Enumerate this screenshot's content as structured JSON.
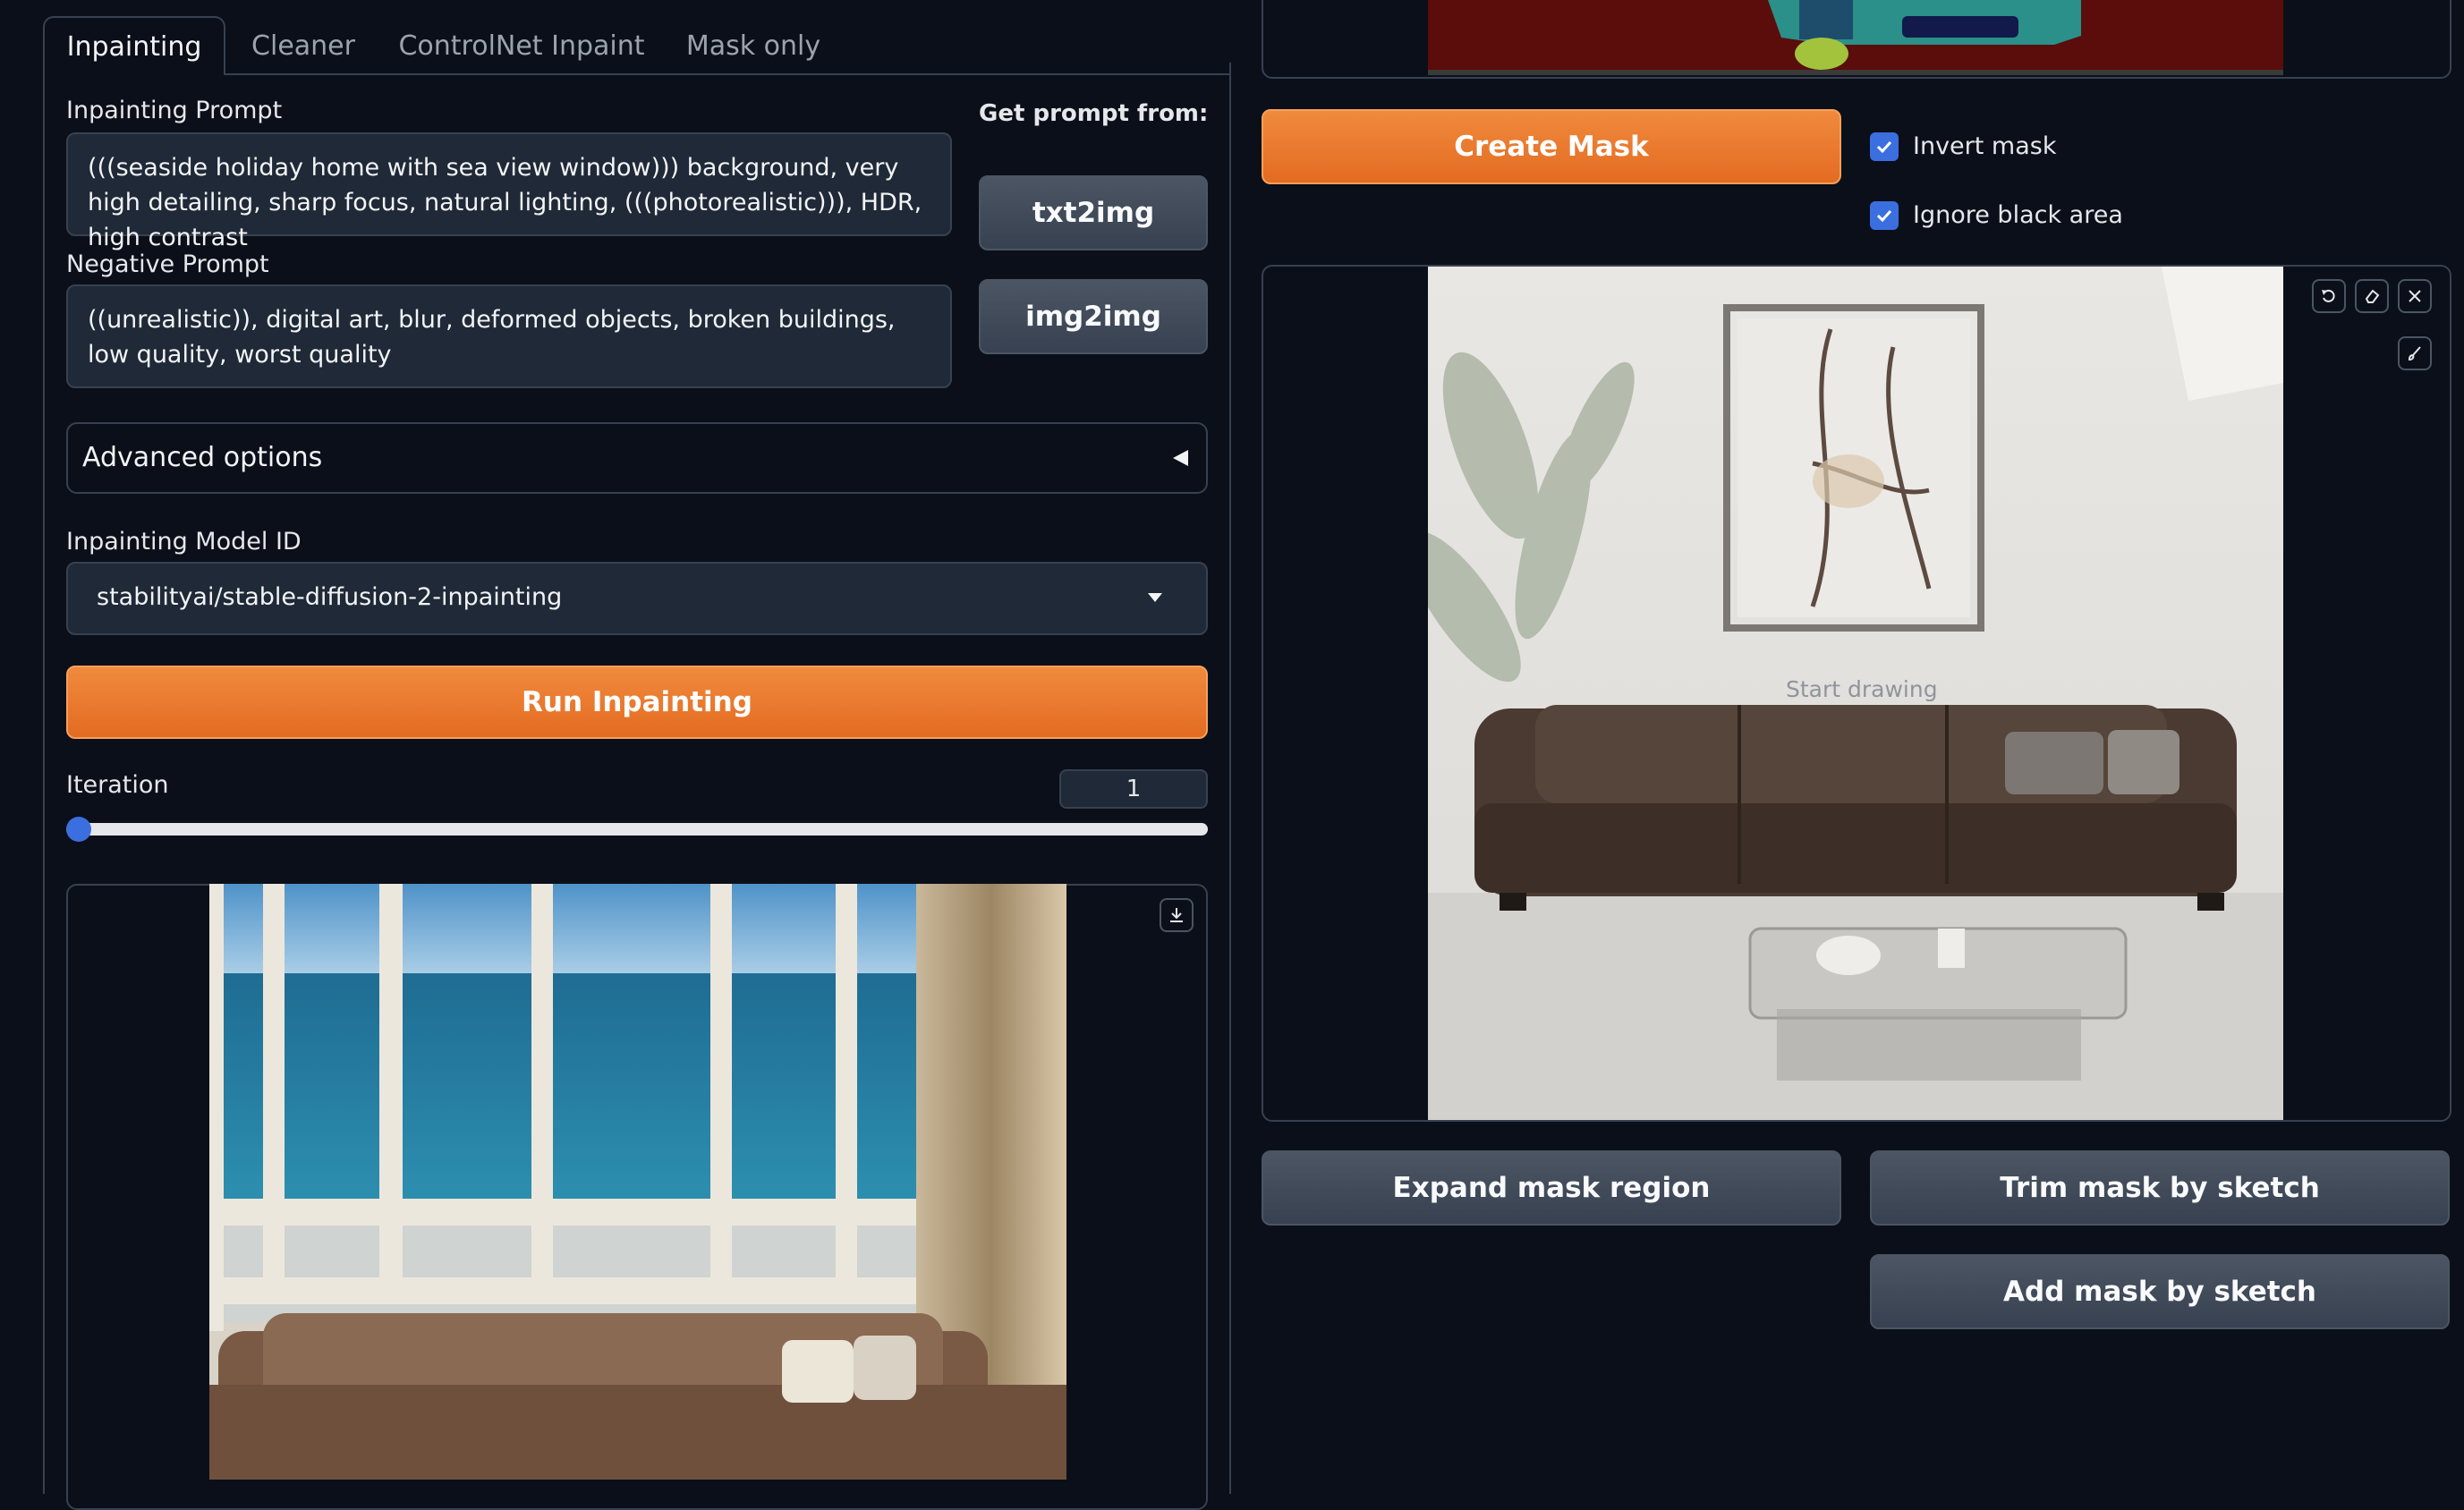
{
  "tabs": [
    {
      "label": "Inpainting",
      "active": true
    },
    {
      "label": "Cleaner",
      "active": false
    },
    {
      "label": "ControlNet Inpaint",
      "active": false
    },
    {
      "label": "Mask only",
      "active": false
    }
  ],
  "prompt": {
    "label": "Inpainting Prompt",
    "value": "(((seaside holiday home with sea view window))) background, very high detailing, sharp focus, natural lighting, (((photorealistic))), HDR, high contrast"
  },
  "negative_prompt": {
    "label": "Negative Prompt",
    "value": "((unrealistic)), digital art, blur, deformed objects, broken buildings, low quality, worst quality"
  },
  "get_prompt": {
    "label": "Get prompt from:",
    "txt2img": "txt2img",
    "img2img": "img2img"
  },
  "advanced_options": {
    "label": "Advanced options"
  },
  "model": {
    "label": "Inpainting Model ID",
    "value": "stabilityai/stable-diffusion-2-inpainting"
  },
  "run_button": "Run Inpainting",
  "iteration": {
    "label": "Iteration",
    "value": "1",
    "slider_fraction": 0
  },
  "mask": {
    "create_button": "Create Mask",
    "invert_label": "Invert mask",
    "invert_checked": true,
    "ignore_label": "Ignore black area",
    "ignore_checked": true,
    "canvas_placeholder": "Start drawing",
    "expand_button": "Expand mask region",
    "trim_button": "Trim mask by sketch",
    "add_button": "Add mask by sketch"
  },
  "colors": {
    "background": "#0b0f19",
    "accent_orange": "#e8742b",
    "checkbox_blue": "#3b6fe0",
    "mask_red": "#5a0d0a",
    "mask_teal": "#2b8f8a"
  },
  "icons": [
    "undo-icon",
    "eraser-icon",
    "close-icon",
    "brush-icon",
    "download-icon",
    "caret-left-icon",
    "chevron-down-icon",
    "check-icon"
  ]
}
